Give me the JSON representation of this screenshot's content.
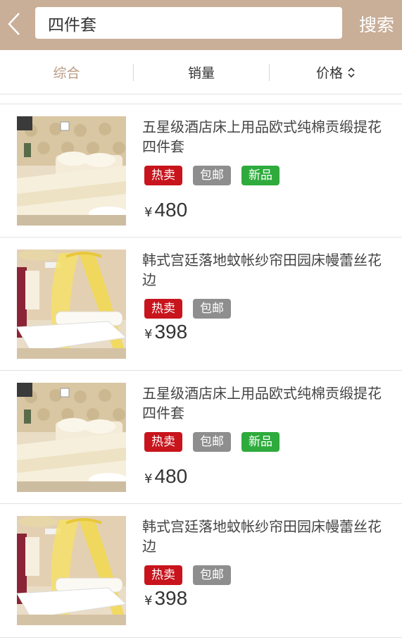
{
  "header": {
    "search_value": "四件套",
    "search_button_label": "搜索",
    "back_icon": "chevron-left-icon"
  },
  "sort": {
    "tabs": [
      {
        "label": "综合",
        "active": true
      },
      {
        "label": "销量",
        "active": false
      },
      {
        "label": "价格",
        "active": false,
        "icon": "sort-updown-icon"
      }
    ]
  },
  "colors": {
    "header_bg": "#c9ae98",
    "active_tab": "#b99b84",
    "tag_hot": "#c8141c",
    "tag_free_shipping": "#8e8e8e",
    "tag_new": "#2eab3c"
  },
  "products": [
    {
      "title": "五星级酒店床上用品欧式纯棉贡缎提花四件套",
      "image": "cream-bedding-set-image",
      "tags": [
        {
          "label": "热卖",
          "color": "#c8141c"
        },
        {
          "label": "包邮",
          "color": "#8e8e8e"
        },
        {
          "label": "新品",
          "color": "#2eab3c"
        }
      ],
      "currency": "¥",
      "price": "480"
    },
    {
      "title": "韩式宫廷落地蚊帐纱帘田园床幔蕾丝花边",
      "image": "yellow-canopy-bed-image",
      "tags": [
        {
          "label": "热卖",
          "color": "#c8141c"
        },
        {
          "label": "包邮",
          "color": "#8e8e8e"
        }
      ],
      "currency": "¥",
      "price": "398"
    },
    {
      "title": "五星级酒店床上用品欧式纯棉贡缎提花四件套",
      "image": "cream-bedding-set-image",
      "tags": [
        {
          "label": "热卖",
          "color": "#c8141c"
        },
        {
          "label": "包邮",
          "color": "#8e8e8e"
        },
        {
          "label": "新品",
          "color": "#2eab3c"
        }
      ],
      "currency": "¥",
      "price": "480"
    },
    {
      "title": "韩式宫廷落地蚊帐纱帘田园床幔蕾丝花边",
      "image": "yellow-canopy-bed-image",
      "tags": [
        {
          "label": "热卖",
          "color": "#c8141c"
        },
        {
          "label": "包邮",
          "color": "#8e8e8e"
        }
      ],
      "currency": "¥",
      "price": "398"
    }
  ]
}
